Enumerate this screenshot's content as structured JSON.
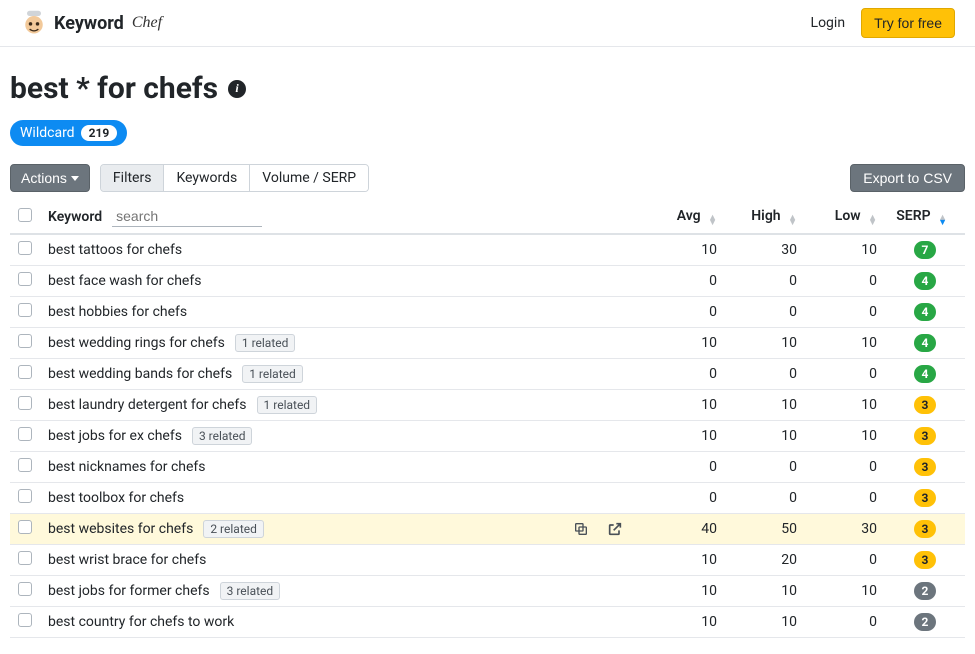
{
  "header": {
    "brand_main": "Keyword",
    "brand_sub": "Chef",
    "login_label": "Login",
    "try_label": "Try for free"
  },
  "page": {
    "title": "best * for chefs",
    "wildcard_label": "Wildcard",
    "wildcard_count": "219"
  },
  "toolbar": {
    "actions_label": "Actions",
    "tabs": {
      "filters": "Filters",
      "keywords": "Keywords",
      "volume_serp": "Volume / SERP"
    },
    "export_label": "Export to CSV"
  },
  "table": {
    "headers": {
      "keyword": "Keyword",
      "search_placeholder": "search",
      "avg": "Avg",
      "high": "High",
      "low": "Low",
      "serp": "SERP"
    },
    "rows": [
      {
        "keyword": "best tattoos for chefs",
        "related": null,
        "avg": "10",
        "high": "30",
        "low": "10",
        "serp": "7",
        "serp_color": "green",
        "hover": false
      },
      {
        "keyword": "best face wash for chefs",
        "related": null,
        "avg": "0",
        "high": "0",
        "low": "0",
        "serp": "4",
        "serp_color": "green",
        "hover": false
      },
      {
        "keyword": "best hobbies for chefs",
        "related": null,
        "avg": "0",
        "high": "0",
        "low": "0",
        "serp": "4",
        "serp_color": "green",
        "hover": false
      },
      {
        "keyword": "best wedding rings for chefs",
        "related": "1 related",
        "avg": "10",
        "high": "10",
        "low": "10",
        "serp": "4",
        "serp_color": "green",
        "hover": false
      },
      {
        "keyword": "best wedding bands for chefs",
        "related": "1 related",
        "avg": "0",
        "high": "0",
        "low": "0",
        "serp": "4",
        "serp_color": "green",
        "hover": false
      },
      {
        "keyword": "best laundry detergent for chefs",
        "related": "1 related",
        "avg": "10",
        "high": "10",
        "low": "10",
        "serp": "3",
        "serp_color": "yellow",
        "hover": false
      },
      {
        "keyword": "best jobs for ex chefs",
        "related": "3 related",
        "avg": "10",
        "high": "10",
        "low": "10",
        "serp": "3",
        "serp_color": "yellow",
        "hover": false
      },
      {
        "keyword": "best nicknames for chefs",
        "related": null,
        "avg": "0",
        "high": "0",
        "low": "0",
        "serp": "3",
        "serp_color": "yellow",
        "hover": false
      },
      {
        "keyword": "best toolbox for chefs",
        "related": null,
        "avg": "0",
        "high": "0",
        "low": "0",
        "serp": "3",
        "serp_color": "yellow",
        "hover": false
      },
      {
        "keyword": "best websites for chefs",
        "related": "2 related",
        "avg": "40",
        "high": "50",
        "low": "30",
        "serp": "3",
        "serp_color": "yellow",
        "hover": true
      },
      {
        "keyword": "best wrist brace for chefs",
        "related": null,
        "avg": "10",
        "high": "20",
        "low": "0",
        "serp": "3",
        "serp_color": "yellow",
        "hover": false
      },
      {
        "keyword": "best jobs for former chefs",
        "related": "3 related",
        "avg": "10",
        "high": "10",
        "low": "10",
        "serp": "2",
        "serp_color": "grey",
        "hover": false
      },
      {
        "keyword": "best country for chefs to work",
        "related": null,
        "avg": "10",
        "high": "10",
        "low": "0",
        "serp": "2",
        "serp_color": "grey",
        "hover": false
      }
    ]
  }
}
